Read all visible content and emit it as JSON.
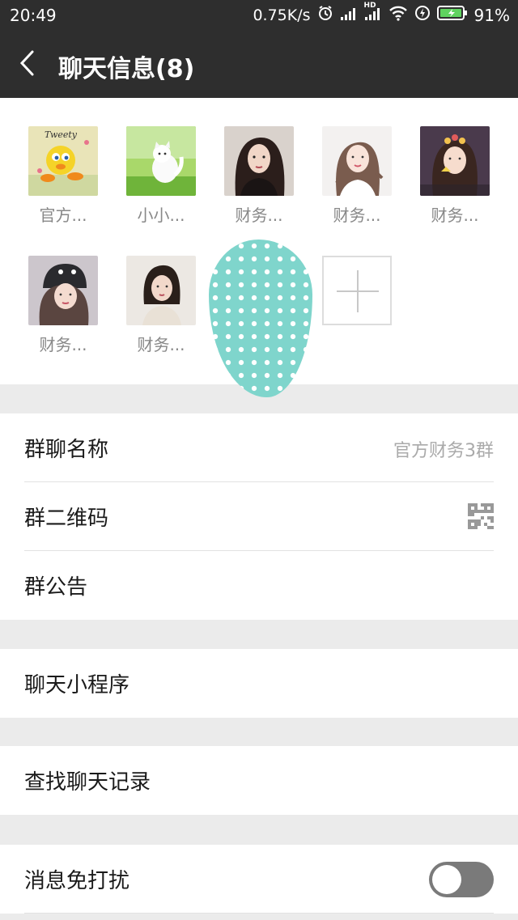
{
  "status_bar": {
    "time": "20:49",
    "network_speed": "0.75K/s",
    "signal_label": "HD",
    "battery": "91%",
    "icons": [
      "alarm-icon",
      "signal-icon",
      "hd-signal-icon",
      "wifi-icon",
      "charging-icon",
      "battery-icon"
    ]
  },
  "header": {
    "title": "聊天信息(8)",
    "back_icon": "chevron-left-icon"
  },
  "members": [
    {
      "name": "官方...",
      "avatar": "tweety-bird-avatar"
    },
    {
      "name": "小小...",
      "avatar": "white-cat-avatar"
    },
    {
      "name": "财务...",
      "avatar": "girl-dark-hair-avatar"
    },
    {
      "name": "财务...",
      "avatar": "girl-selfie-avatar"
    },
    {
      "name": "财务...",
      "avatar": "girl-sticker-avatar"
    },
    {
      "name": "财务...",
      "avatar": "girl-cat-hat-avatar"
    },
    {
      "name": "财务...",
      "avatar": "girl-short-hair-avatar"
    }
  ],
  "add_member_icon": "plus-icon",
  "settings": {
    "group_name_label": "群聊名称",
    "group_name_value": "官方财务3群",
    "qr_code_label": "群二维码",
    "announcement_label": "群公告",
    "mini_programs_label": "聊天小程序",
    "search_history_label": "查找聊天记录",
    "mute_label": "消息免打扰",
    "mute_enabled": false
  },
  "colors": {
    "header_bg": "#2e2e2e",
    "page_bg": "#ebebeb",
    "blob_teal": "#7fd5cc",
    "toggle_off": "#7a7a7a"
  }
}
